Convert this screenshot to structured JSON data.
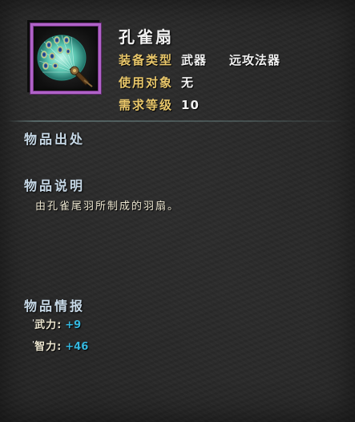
{
  "item": {
    "name": "孔雀扇",
    "icon": "peacock-fan-icon",
    "rarity_color": "#b062c8"
  },
  "attributes": [
    {
      "key": "装备类型",
      "value": "武器",
      "value2": "远攻法器"
    },
    {
      "key": "使用对象",
      "value": "无"
    },
    {
      "key": "需求等级",
      "value": "10"
    }
  ],
  "sections": {
    "source_title": "物品出处",
    "description_title": "物品说明",
    "description_text": "由孔雀尾羽所制成的羽扇。",
    "info_title": "物品情报"
  },
  "stats": [
    {
      "bullet": "'",
      "key": "武力:",
      "value": "+9"
    },
    {
      "bullet": "'",
      "key": "智力:",
      "value": "+46"
    }
  ],
  "colors": {
    "attr_key": "#e8c66a",
    "section_title": "#c8dae8",
    "stat_value": "#35b8e0"
  }
}
